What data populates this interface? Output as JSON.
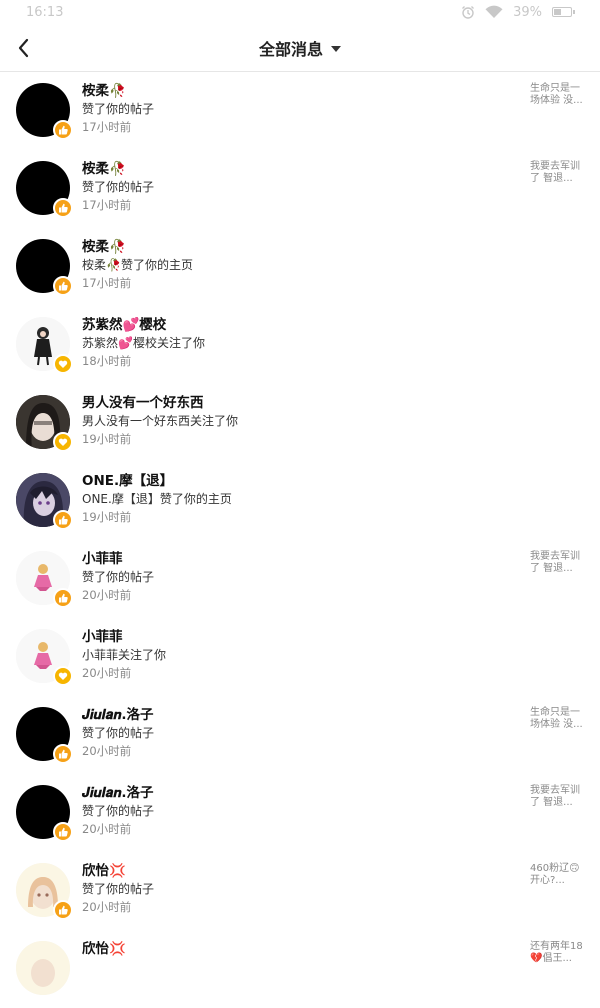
{
  "status": {
    "time": "16:13",
    "battery": "39%"
  },
  "header": {
    "title": "全部消息"
  },
  "messages": [
    {
      "name": "桉柔🥀",
      "action": "赞了你的帖子",
      "time": "17小时前",
      "snippet": "生命只是一场体验 没..."
    },
    {
      "name": "桉柔🥀",
      "action": "赞了你的帖子",
      "time": "17小时前",
      "snippet": "我要去军训了 智退..."
    },
    {
      "name": "桉柔🥀",
      "action": "桉柔🥀赞了你的主页",
      "time": "17小时前",
      "snippet": ""
    },
    {
      "name": "苏紫然💕樱校",
      "action": "苏紫然💕樱校关注了你",
      "time": "18小时前",
      "snippet": ""
    },
    {
      "name": "男人没有一个好东西",
      "action": "男人没有一个好东西关注了你",
      "time": "19小时前",
      "snippet": ""
    },
    {
      "name": "ONE.摩【退】",
      "action": "ONE.摩【退】赞了你的主页",
      "time": "19小时前",
      "snippet": ""
    },
    {
      "name": "小菲菲",
      "action": "赞了你的帖子",
      "time": "20小时前",
      "snippet": "我要去军训了 智退..."
    },
    {
      "name": "小菲菲",
      "action": "小菲菲关注了你",
      "time": "20小时前",
      "snippet": ""
    },
    {
      "name": "𝑱𝒊𝒖𝒍𝒂𝒏.洛子",
      "action": "赞了你的帖子",
      "time": "20小时前",
      "snippet": "生命只是一场体验 没..."
    },
    {
      "name": "𝑱𝒊𝒖𝒍𝒂𝒏.洛子",
      "action": "赞了你的帖子",
      "time": "20小时前",
      "snippet": "我要去军训了 智退..."
    },
    {
      "name": "欣怡💢",
      "action": "赞了你的帖子",
      "time": "20小时前",
      "snippet": "460粉辽🙃开心?..."
    },
    {
      "name": "欣怡💢",
      "action": "",
      "time": "",
      "snippet": "还有两年18💔倡王..."
    }
  ]
}
